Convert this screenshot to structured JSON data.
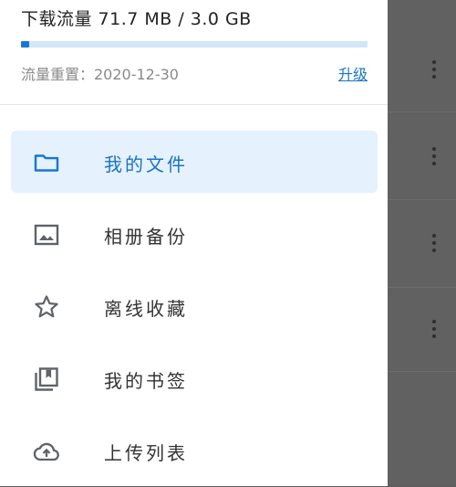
{
  "quota": {
    "title": "下载流量 71.7 MB / 3.0 GB",
    "used_fraction": 0.023,
    "reset_text": "流量重置：2020-12-30",
    "upgrade_label": "升级"
  },
  "menu": {
    "items": [
      {
        "label": "我的文件",
        "icon": "folder-icon",
        "selected": true
      },
      {
        "label": "相册备份",
        "icon": "image-icon",
        "selected": false
      },
      {
        "label": "离线收藏",
        "icon": "star-icon",
        "selected": false
      },
      {
        "label": "我的书签",
        "icon": "bookmarks-icon",
        "selected": false
      },
      {
        "label": "上传列表",
        "icon": "cloud-upload-icon",
        "selected": false
      }
    ]
  },
  "colors": {
    "accent": "#1677d6",
    "selected_bg": "#e5f1fc",
    "icon_gray": "#5f6368"
  }
}
